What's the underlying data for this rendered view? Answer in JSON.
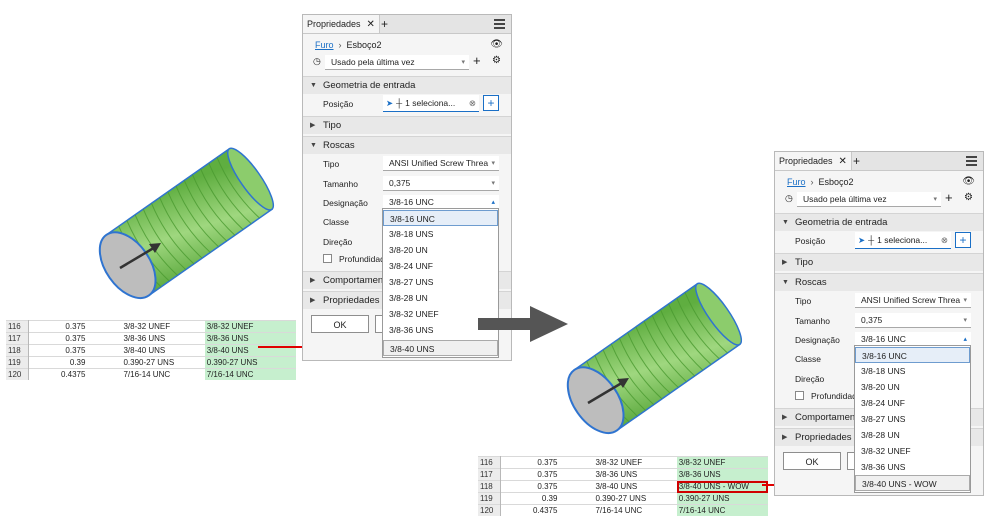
{
  "colors": {
    "accent": "#1a6fc6",
    "cylinder_green": "#7ac35a",
    "cylinder_end": "#bdbdbd",
    "highlight_red": "#e00000",
    "cell_green": "#c6efce"
  },
  "left_panel": {
    "tab_title": "Propriedades",
    "breadcrumb_root": "Furo",
    "breadcrumb_current": "Esboço2",
    "preset_value": "Usado pela última vez",
    "section_input_geometry": "Geometria de entrada",
    "position_label": "Posição",
    "position_value": "1 seleciona...",
    "section_type": "Tipo",
    "section_threads": "Roscas",
    "type_label": "Tipo",
    "type_value": "ANSI Unified Screw Threa",
    "size_label": "Tamanho",
    "size_value": "0,375",
    "designation_label": "Designação",
    "designation_value": "3/8-16 UNC",
    "class_label": "Classe",
    "direction_label": "Direção",
    "depth_label": "Profundidad",
    "section_behavior": "Comportament",
    "section_advanced": "Propriedades a",
    "ok_label": "OK",
    "dropdown_options": [
      "3/8-16 UNC",
      "3/8-18 UNS",
      "3/8-20 UN",
      "3/8-24 UNF",
      "3/8-27 UNS",
      "3/8-28 UN",
      "3/8-32 UNEF",
      "3/8-36 UNS",
      "3/8-40 UNS"
    ]
  },
  "right_panel": {
    "tab_title": "Propriedades",
    "breadcrumb_root": "Furo",
    "breadcrumb_current": "Esboço2",
    "preset_value": "Usado pela última vez",
    "section_input_geometry": "Geometria de entrada",
    "position_label": "Posição",
    "position_value": "1 seleciona...",
    "section_type": "Tipo",
    "section_threads": "Roscas",
    "type_label": "Tipo",
    "type_value": "ANSI Unified Screw Threa",
    "size_label": "Tamanho",
    "size_value": "0,375",
    "designation_label": "Designação",
    "designation_value": "3/8-16 UNC",
    "class_label": "Classe",
    "direction_label": "Direção",
    "depth_label": "Profundidad",
    "section_behavior": "Comportamen",
    "section_advanced": "Propriedades a",
    "ok_label": "OK",
    "dropdown_options": [
      "3/8-16 UNC",
      "3/8-18 UNS",
      "3/8-20 UN",
      "3/8-24 UNF",
      "3/8-27 UNS",
      "3/8-28 UN",
      "3/8-32 UNEF",
      "3/8-36 UNS",
      "3/8-40 UNS - WOW"
    ]
  },
  "left_sheet": {
    "rows": [
      [
        "116",
        "0.375",
        "3/8-32 UNEF",
        "3/8-32 UNEF"
      ],
      [
        "117",
        "0.375",
        "3/8-36 UNS",
        "3/8-36 UNS"
      ],
      [
        "118",
        "0.375",
        "3/8-40 UNS",
        "3/8-40 UNS"
      ],
      [
        "119",
        "0.39",
        "0.390-27 UNS",
        "0.390-27 UNS"
      ],
      [
        "120",
        "0.4375",
        "7/16-14 UNC",
        "7/16-14 UNC"
      ]
    ]
  },
  "right_sheet": {
    "rows": [
      [
        "116",
        "0.375",
        "3/8-32 UNEF",
        "3/8-32 UNEF"
      ],
      [
        "117",
        "0.375",
        "3/8-36 UNS",
        "3/8-36 UNS"
      ],
      [
        "118",
        "0.375",
        "3/8-40 UNS",
        "3/8-40 UNS - WOW"
      ],
      [
        "119",
        "0.39",
        "0.390-27 UNS",
        "0.390-27 UNS"
      ],
      [
        "120",
        "0.4375",
        "7/16-14 UNC",
        "7/16-14 UNC"
      ]
    ]
  }
}
